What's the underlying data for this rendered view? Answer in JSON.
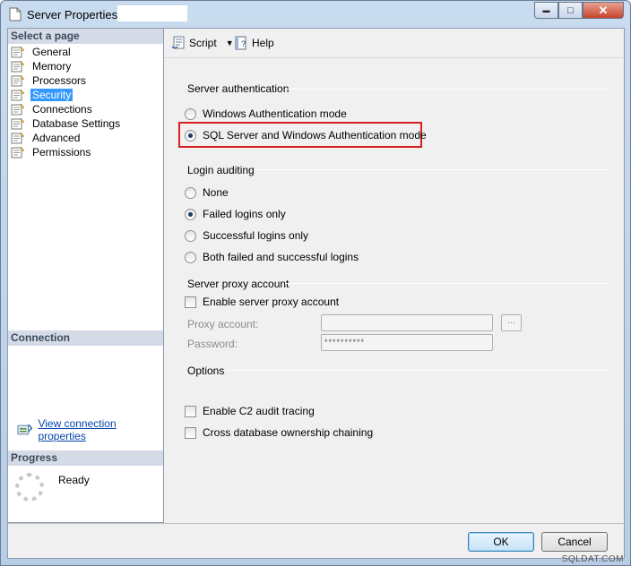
{
  "window": {
    "title": "Server Properties -",
    "controls": {
      "minimize": "▬",
      "maximize": "□",
      "close": "✕"
    }
  },
  "left": {
    "select_page_header": "Select a page",
    "pages": [
      {
        "label": "General",
        "icon": "page-icon"
      },
      {
        "label": "Memory",
        "icon": "page-icon"
      },
      {
        "label": "Processors",
        "icon": "page-icon"
      },
      {
        "label": "Security",
        "icon": "page-icon",
        "selected": true
      },
      {
        "label": "Connections",
        "icon": "page-icon"
      },
      {
        "label": "Database Settings",
        "icon": "page-icon"
      },
      {
        "label": "Advanced",
        "icon": "page-icon"
      },
      {
        "label": "Permissions",
        "icon": "page-icon"
      }
    ],
    "connection_header": "Connection",
    "connection_link": "View connection properties",
    "progress_header": "Progress",
    "progress_status": "Ready"
  },
  "toolbar": {
    "script_label": "Script",
    "help_label": "Help"
  },
  "security": {
    "server_auth_title": "Server authentication",
    "auth_windows": "Windows Authentication mode",
    "auth_mixed": "SQL Server and Windows Authentication mode",
    "auth_selected": "mixed",
    "login_auditing_title": "Login auditing",
    "audit_none": "None",
    "audit_failed": "Failed logins only",
    "audit_successful": "Successful logins only",
    "audit_both": "Both failed and successful logins",
    "audit_selected": "failed",
    "proxy_title": "Server proxy account",
    "enable_proxy": "Enable server proxy account",
    "proxy_account_label": "Proxy account:",
    "proxy_account_value": "",
    "password_label": "Password:",
    "password_value": "**********",
    "browse_label": "...",
    "options_title": "Options",
    "c2_audit": "Enable C2 audit tracing",
    "cross_db": "Cross database ownership chaining"
  },
  "buttons": {
    "ok": "OK",
    "cancel": "Cancel"
  },
  "watermark": "SQLDAT.COM",
  "colors": {
    "highlight_box": "#d81e1e",
    "selection": "#3399ff",
    "link": "#0645ad"
  }
}
